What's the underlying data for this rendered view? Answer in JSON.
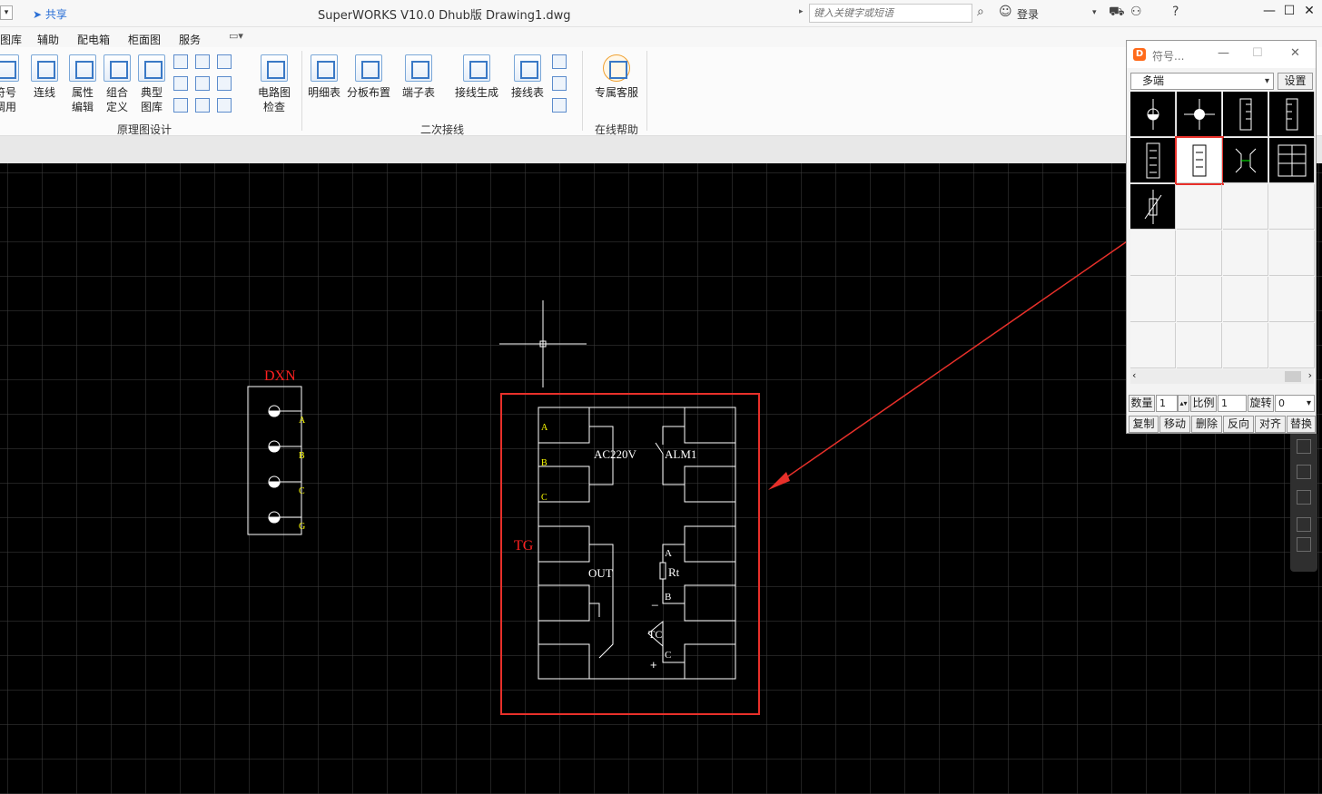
{
  "titlebar": {
    "share": "共享",
    "title": "SuperWORKS V10.0 Dhub版    Drawing1.dwg",
    "search_placeholder": "键入关键字或短语",
    "login": "登录"
  },
  "menu": [
    "图库",
    "辅助",
    "配电箱",
    "柜面图",
    "服务"
  ],
  "ribbon": {
    "buttons": [
      {
        "label": "符号\n调用"
      },
      {
        "label": "连线"
      },
      {
        "label": "属性\n编辑"
      },
      {
        "label": "组合\n定义"
      },
      {
        "label": "典型\n图库"
      },
      {
        "label": "电路图\n检查"
      },
      {
        "label": "明细表"
      },
      {
        "label": "分板布置"
      },
      {
        "label": "端子表"
      },
      {
        "label": "接线生成"
      },
      {
        "label": "接线表"
      },
      {
        "label": "专属客服"
      }
    ],
    "groups": [
      "原理图设计",
      "二次接线",
      "在线帮助"
    ]
  },
  "drawing": {
    "dxn_label": "DXN",
    "dxn_pins": [
      "A",
      "B",
      "C",
      "G"
    ],
    "tg_label": "TG",
    "left_pins": [
      "A",
      "B",
      "C"
    ],
    "ac_label": "AC220V",
    "alm_label": "ALM1",
    "out_label": "OUT",
    "rt_label": "Rt",
    "tc_label": "TC",
    "right_pins": [
      "A",
      "B",
      "C"
    ],
    "minus": "_",
    "plus": "+"
  },
  "symbol_panel": {
    "title": "符号...",
    "category": "多端",
    "settings": "设置",
    "quantity_label": "数量",
    "quantity_value": "1",
    "scale_label": "比例",
    "scale_value": "1",
    "rotate_label": "旋转",
    "rotate_value": "0",
    "actions": [
      "复制",
      "移动",
      "删除",
      "反向",
      "对齐",
      "替换"
    ]
  },
  "colors": {
    "highlight": "#e8302a",
    "drawing_line": "#ffffff",
    "pin_label": "#ffff00",
    "tag_label": "#ff2020",
    "ribbon_bg": "#fbfbfb"
  }
}
